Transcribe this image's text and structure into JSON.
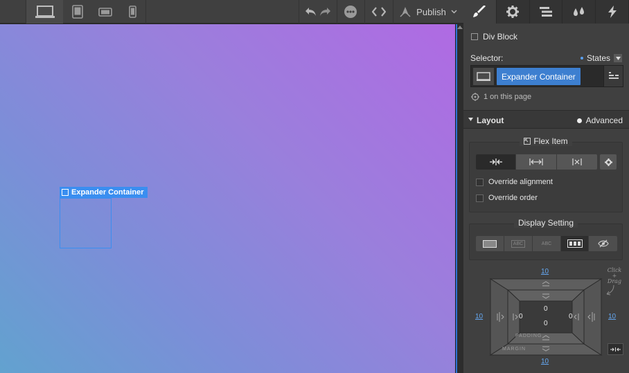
{
  "toolbar": {
    "publish_label": "Publish",
    "icons": [
      "desktop-icon",
      "tablet-icon",
      "mobile-landscape-icon",
      "mobile-portrait-icon",
      "undo-icon",
      "redo-icon",
      "comments-icon",
      "code-icon",
      "publish-rocket-icon",
      "chevron-down-icon"
    ]
  },
  "canvas": {
    "selected_element_label": "Expander Container",
    "accent": "#3a8ef0"
  },
  "panel": {
    "tabs": [
      "style-brush-icon",
      "settings-gear-icon",
      "navigator-icon",
      "interactions-drops-icon",
      "lightning-icon"
    ],
    "element_type": "Div Block",
    "selector_label": "Selector:",
    "states_label": "States",
    "selector_chip": "Expander Container",
    "on_page_text": "1 on this page",
    "layout_section": {
      "title": "Layout",
      "advanced_label": "Advanced"
    },
    "flex_item": {
      "title": "Flex Item",
      "override_alignment": "Override alignment",
      "override_order": "Override order"
    },
    "display_setting": {
      "title": "Display Setting",
      "options": [
        "Block",
        "ABC",
        "ABC",
        "Flex",
        "None"
      ]
    },
    "box_model": {
      "margin_top": "10",
      "margin_bottom": "10",
      "margin_left": "10",
      "margin_right": "10",
      "padding_top": "0",
      "padding_bottom": "0",
      "padding_left": "0",
      "padding_right": "0",
      "padding_caption": "PADDING",
      "margin_caption": "MARGIN",
      "hint": "Click + Drag"
    }
  }
}
